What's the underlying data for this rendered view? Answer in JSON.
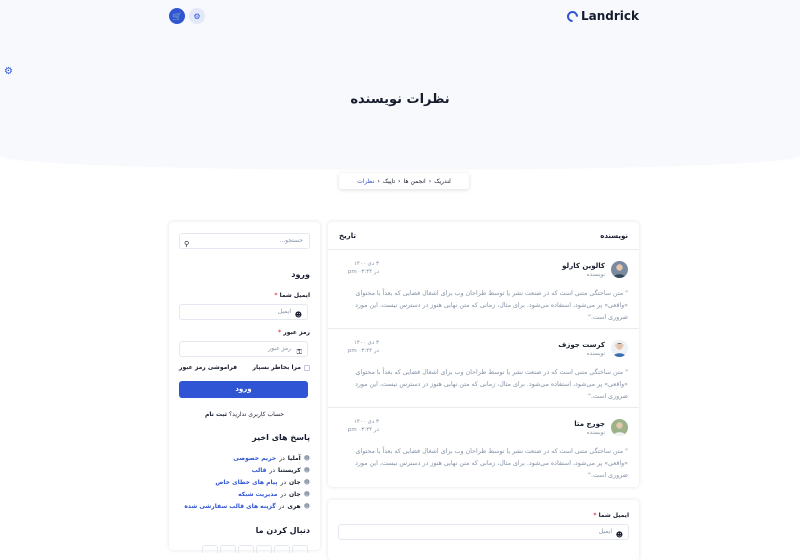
{
  "header": {
    "brand": "Landrick",
    "cart_icon": "cart-icon",
    "gear_icon": "gear-icon"
  },
  "page": {
    "title": "نظرات نویسنده"
  },
  "breadcrumb": [
    "لندریک",
    "انجمن ها",
    "تاپیک",
    "نظرات"
  ],
  "table": {
    "col_author": "نویسنده",
    "col_date": "تاریخ",
    "rows": [
      {
        "name": "کالوین کارلو",
        "role": "نویسنده",
        "date": "۳ دی ۱۴۰۰",
        "time": "در ۰۳:۴۴ pm",
        "text": "\" متن ساختگی متنی است که در صنعت نشر یا توسط طراحان وب برای اشغال فضایی که بعداً با محتوای «واقعی» پر می‌شود، استفاده می‌شود. برای مثال، زمانی که متن نهایی هنوز در دسترس نیست، این مورد ضروری است.\""
      },
      {
        "name": "کرست جوزف",
        "role": "نویسنده",
        "date": "۳ دی ۱۴۰۰",
        "time": "در ۰۳:۴۴ pm",
        "text": "\" متن ساختگی متنی است که در صنعت نشر یا توسط طراحان وب برای اشغال فضایی که بعداً با محتوای «واقعی» پر می‌شود، استفاده می‌شود. برای مثال، زمانی که متن نهایی هنوز در دسترس نیست، این مورد ضروری است.\""
      },
      {
        "name": "جورج متا",
        "role": "نویسنده",
        "date": "۳ دی ۱۴۰۰",
        "time": "در ۰۳:۴۴ pm",
        "text": "\" متن ساختگی متنی است که در صنعت نشر یا توسط طراحان وب برای اشغال فضایی که بعداً با محتوای «واقعی» پر می‌شود، استفاده می‌شود. برای مثال، زمانی که متن نهایی هنوز در دسترس نیست، این مورد ضروری است.\""
      }
    ]
  },
  "reply_form": {
    "email_label": "ایمیل شما",
    "email_placeholder": "ایمیل"
  },
  "sidebar": {
    "search_placeholder": "جستجو...",
    "login_title": "ورود",
    "email_label": "ایمیل شما",
    "email_placeholder": "ایمیل",
    "password_label": "رمز عبور",
    "password_placeholder": "رمز عبور",
    "remember": "مرا بخاطر بسپار",
    "forgot": "فراموشی رمز عبور",
    "login_button": "ورود",
    "no_account": "حساب کاربری ندارید؟",
    "signup": "ثبت نام",
    "recent_title": "پاسخ های اخیر",
    "replies": [
      {
        "user": "آملیا",
        "in": "در",
        "topic": "حریم خصوصی"
      },
      {
        "user": "کریستنا",
        "in": "در",
        "topic": "قالب"
      },
      {
        "user": "جان",
        "in": "در",
        "topic": "پیام های خطای خاص"
      },
      {
        "user": "جان",
        "in": "در",
        "topic": "مدیریت شبکه"
      },
      {
        "user": "هری",
        "in": "در",
        "topic": "گزینه های قالب سفارشی شده"
      }
    ],
    "follow_title": "دنبال کردن ما"
  },
  "colors": {
    "primary": "#2f55d4",
    "required": "#e43f52",
    "muted": "#8492a6"
  }
}
